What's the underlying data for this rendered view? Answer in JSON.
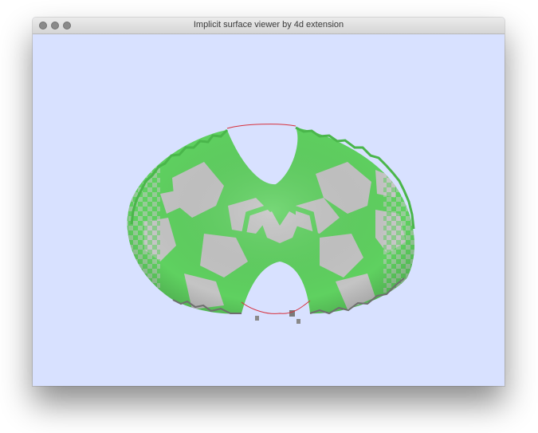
{
  "window": {
    "title": "Implicit surface viewer by 4d extension",
    "background_color": "#d8e1ff",
    "traffic_lights": [
      "close-button",
      "minimize-button",
      "zoom-button"
    ]
  },
  "surface": {
    "primary_color": "#5fd160",
    "secondary_color": "#c4c4c4",
    "boundary_color": "#d6303c"
  }
}
